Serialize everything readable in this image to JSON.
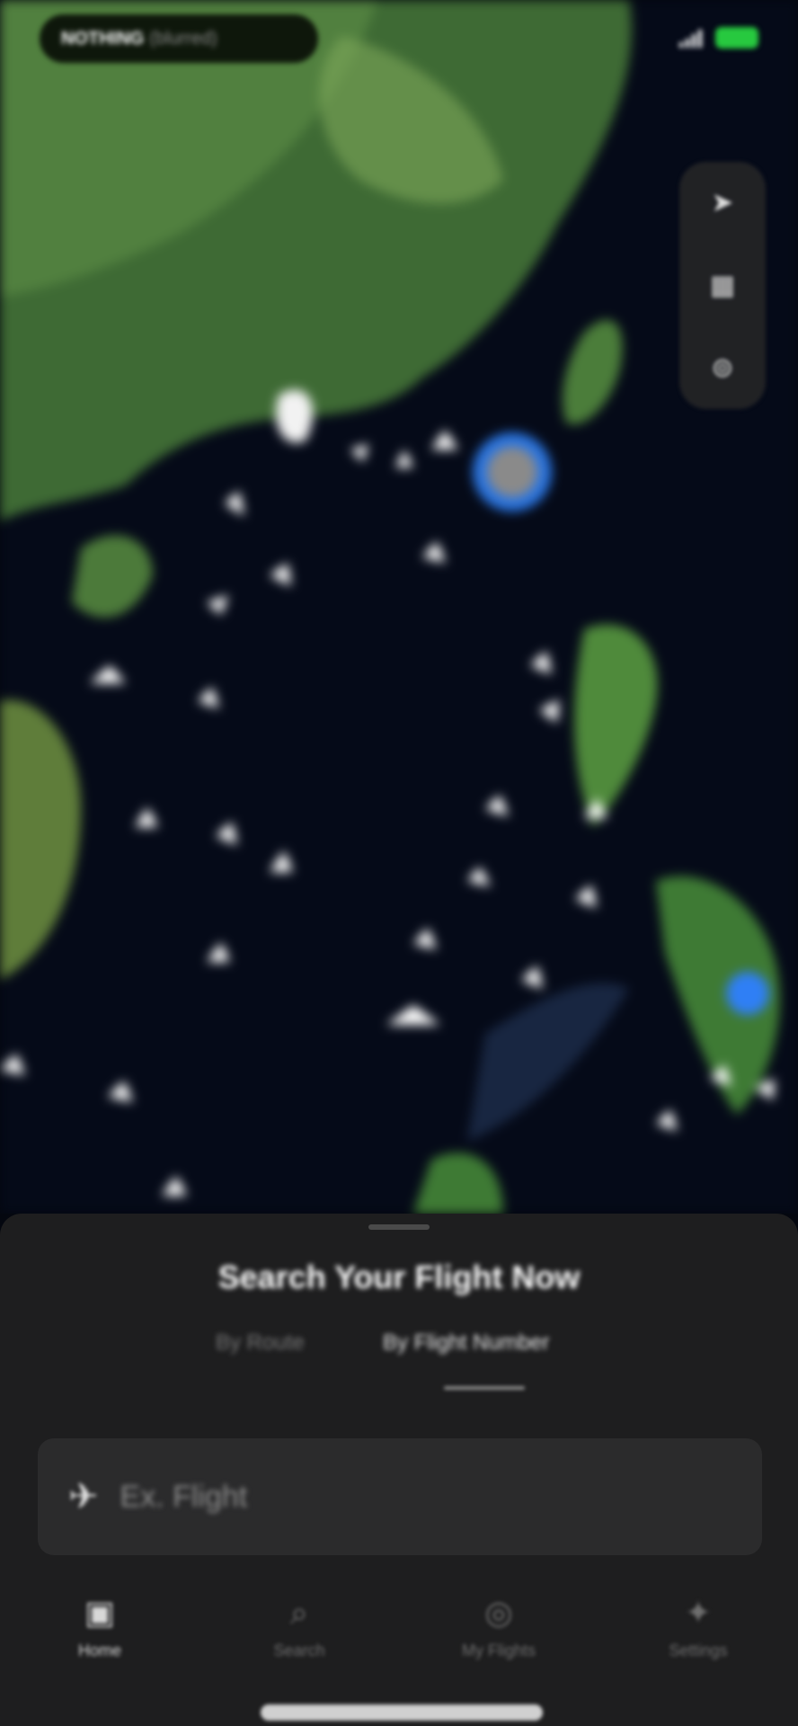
{
  "status_bar": {
    "app_label": "NOTHING",
    "app_label_dim": "(blurred)",
    "battery_color": "#27c93f"
  },
  "map": {
    "controls": [
      {
        "name": "location-arrow-icon",
        "glyph": "➤"
      },
      {
        "name": "layers-icon",
        "glyph": "▦"
      },
      {
        "name": "filter-icon",
        "glyph": "⊚"
      }
    ],
    "colors": {
      "ocean": "#050a18",
      "land": "#3e6a34",
      "accent_marker": "#2f7ff5"
    }
  },
  "sheet": {
    "title": "Search Your Flight Now",
    "tabs": [
      {
        "label": "By Route",
        "active": false
      },
      {
        "label": "By Flight Number",
        "active": true
      }
    ],
    "input_placeholder": "Ex. Flight"
  },
  "tabbar": {
    "items": [
      {
        "label": "Home",
        "icon": "home-icon",
        "glyph": "▣",
        "active": true
      },
      {
        "label": "Search",
        "icon": "search-icon",
        "glyph": "⌕",
        "active": false
      },
      {
        "label": "My Flights",
        "icon": "my-flights-icon",
        "glyph": "◎",
        "active": false
      },
      {
        "label": "Settings",
        "icon": "settings-icon",
        "glyph": "✦",
        "active": false
      }
    ]
  }
}
